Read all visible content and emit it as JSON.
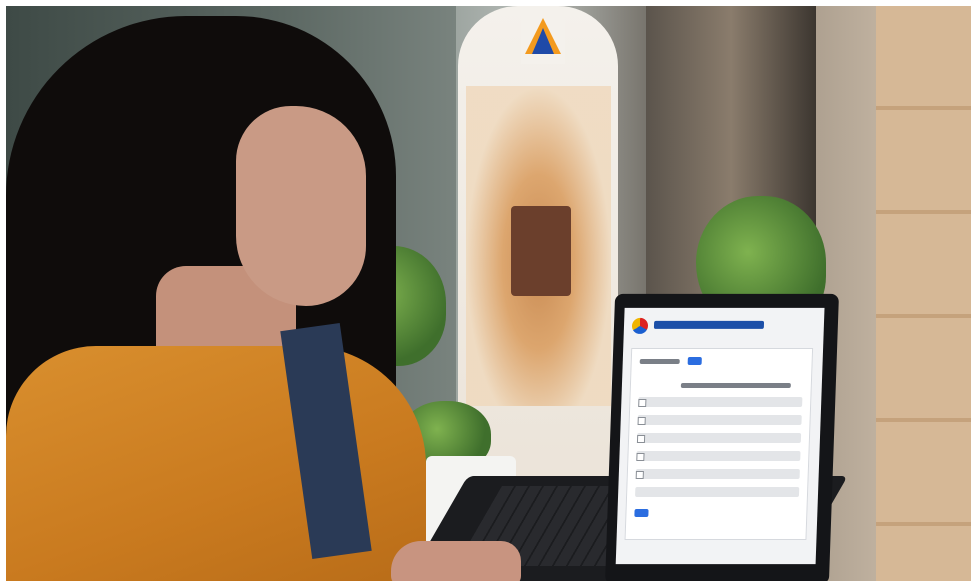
{
  "scene": {
    "subject": "woman-using-laptop",
    "colors": {
      "shirt": "#d98f2e",
      "hair": "#0f0c0b",
      "laptop": "#141518",
      "screen_bg": "#f2f3f5",
      "screen_accent": "#2b6de0"
    }
  },
  "laptop_screen": {
    "icons": [
      "logo-icon"
    ]
  }
}
